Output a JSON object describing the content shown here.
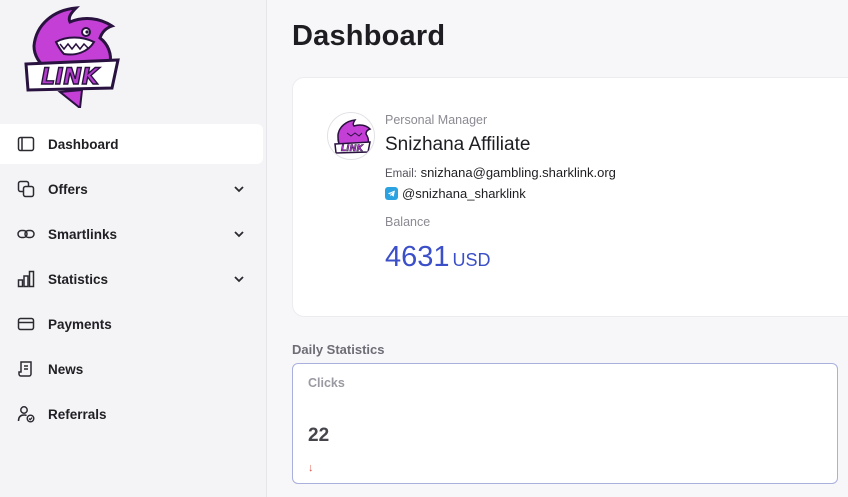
{
  "brand": {
    "logo_text": "LINK",
    "accent": "#c43fd6"
  },
  "sidebar": {
    "items": [
      {
        "label": "Dashboard",
        "icon": "dashboard-icon",
        "active": true,
        "expandable": false
      },
      {
        "label": "Offers",
        "icon": "offers-icon",
        "active": false,
        "expandable": true
      },
      {
        "label": "Smartlinks",
        "icon": "link-icon",
        "active": false,
        "expandable": true
      },
      {
        "label": "Statistics",
        "icon": "bar-chart-icon",
        "active": false,
        "expandable": true
      },
      {
        "label": "Payments",
        "icon": "card-icon",
        "active": false,
        "expandable": false
      },
      {
        "label": "News",
        "icon": "news-icon",
        "active": false,
        "expandable": false
      },
      {
        "label": "Referrals",
        "icon": "user-check-icon",
        "active": false,
        "expandable": false
      }
    ]
  },
  "main": {
    "title": "Dashboard",
    "manager": {
      "caption": "Personal Manager",
      "name": "Snizhana Affiliate",
      "email_label": "Email:",
      "email": "snizhana@gambling.sharklink.org",
      "telegram": "@snizhana_sharklink",
      "balance_caption": "Balance",
      "balance_value": "4631",
      "balance_currency": "USD",
      "balance_color": "#3b4fc8"
    },
    "daily": {
      "title": "Daily Statistics",
      "clicks_label": "Clicks",
      "clicks_value": "22",
      "trend_icon": "arrow-down-icon",
      "trend_glyph": "↓",
      "trend_color": "#e0574a"
    }
  }
}
